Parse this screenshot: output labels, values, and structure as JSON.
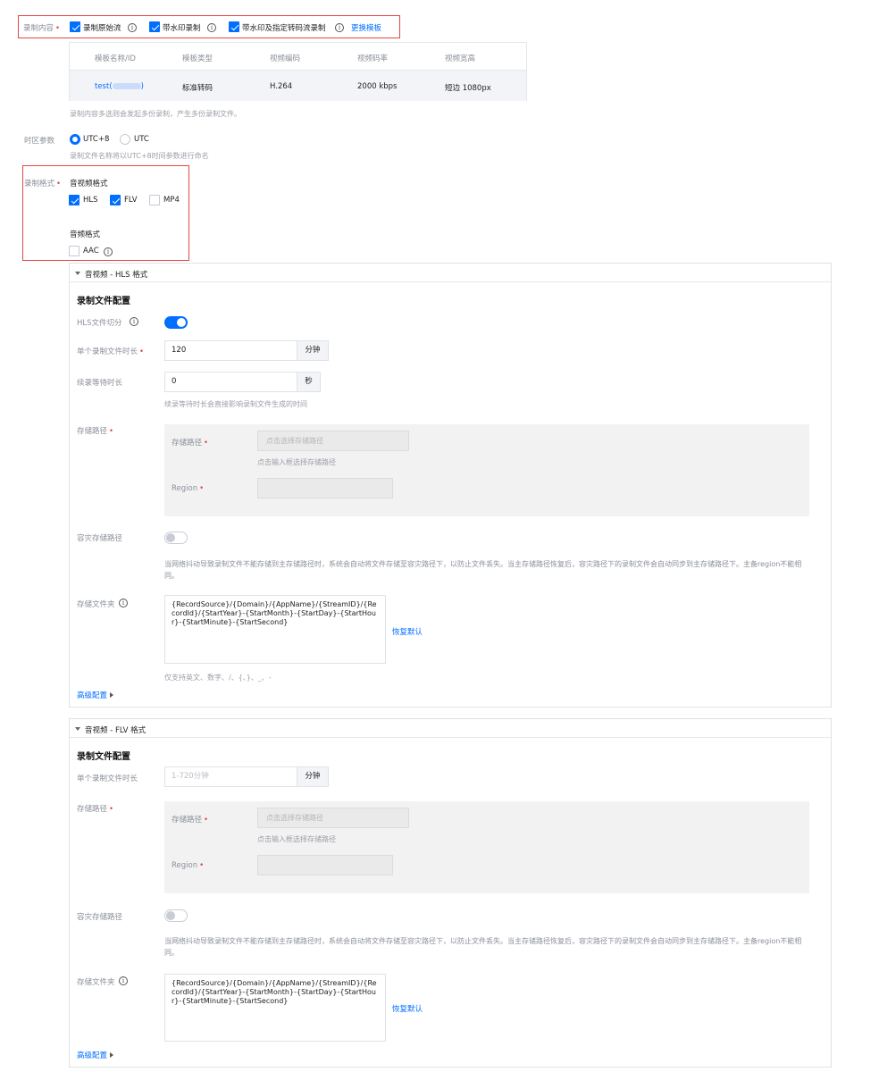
{
  "record_content": {
    "label": "录制内容",
    "options": [
      {
        "label": "录制原始流",
        "checked": true
      },
      {
        "label": "带水印录制",
        "checked": true
      },
      {
        "label": "带水印及指定转码流录制",
        "checked": true
      }
    ],
    "change_template_link": "更换模板",
    "table": {
      "headers": [
        "模板名称/ID",
        "模板类型",
        "视频编码",
        "视频码率",
        "视频宽高"
      ],
      "row": {
        "name_prefix": "test(",
        "name_suffix": ")",
        "type": "标准转码",
        "codec": "H.264",
        "bitrate": "2000 kbps",
        "size": "短边 1080px"
      }
    },
    "hint": "录制内容多选则会发起多份录制，产生多份录制文件。"
  },
  "timezone": {
    "label": "时区参数",
    "options": [
      {
        "label": "UTC+8",
        "selected": true
      },
      {
        "label": "UTC",
        "selected": false
      }
    ],
    "hint": "录制文件名称将以UTC+8时间参数进行命名"
  },
  "record_format": {
    "label": "录制格式",
    "av_title": "音视频格式",
    "av_options": [
      {
        "label": "HLS",
        "checked": true
      },
      {
        "label": "FLV",
        "checked": true
      },
      {
        "label": "MP4",
        "checked": false
      }
    ],
    "audio_title": "音频格式",
    "audio_options": [
      {
        "label": "AAC",
        "checked": false
      }
    ]
  },
  "hls_panel": {
    "header": "音视频 - HLS 格式",
    "section_title": "录制文件配置",
    "split_label": "HLS文件切分",
    "split_on": true,
    "duration_label": "单个录制文件时长",
    "duration_value": "120",
    "duration_unit": "分钟",
    "wait_label": "续录等待时长",
    "wait_value": "0",
    "wait_unit": "秒",
    "wait_hint": "续录等待时长会直接影响录制文件生成的时间",
    "storage_label": "存储路径",
    "storage_path_label": "存储路径",
    "storage_path_placeholder": "点击选择存储路径",
    "storage_path_hint": "点击输入框选择存储路径",
    "region_label": "Region",
    "backup_label": "容灾存储路径",
    "backup_on": false,
    "backup_desc": "当网络抖动导致录制文件不能存储到主存储路径时，系统会自动将文件存储至容灾路径下，以防止文件丢失。当主存储路径恢复后，容灾路径下的录制文件会自动同步到主存储路径下。主备region不能相同。",
    "folder_label": "存储文件夹",
    "folder_value": "{RecordSource}/{Domain}/{AppName}/{StreamID}/{RecordId}/{StartYear}-{StartMonth}-{StartDay}-{StartHour}-{StartMinute}-{StartSecond}",
    "restore_link": "恢复默认",
    "folder_hint": "仅支持英文、数字、/、{、}、_、-",
    "advanced": "高级配置"
  },
  "flv_panel": {
    "header": "音视频 - FLV 格式",
    "section_title": "录制文件配置",
    "duration_label": "单个录制文件时长",
    "duration_placeholder": "1-720分钟",
    "duration_unit": "分钟",
    "storage_label": "存储路径",
    "storage_path_label": "存储路径",
    "storage_path_placeholder": "点击选择存储路径",
    "storage_path_hint": "点击输入框选择存储路径",
    "region_label": "Region",
    "backup_label": "容灾存储路径",
    "backup_on": false,
    "backup_desc": "当网络抖动导致录制文件不能存储到主存储路径时，系统会自动将文件存储至容灾路径下，以防止文件丢失。当主存储路径恢复后，容灾路径下的录制文件会自动同步到主存储路径下。主备region不能相同。",
    "folder_label": "存储文件夹",
    "folder_value": "{RecordSource}/{Domain}/{AppName}/{StreamID}/{RecordId}/{StartYear}-{StartMonth}-{StartDay}-{StartHour}-{StartMinute}-{StartSecond}",
    "restore_link": "恢复默认",
    "advanced": "高级配置"
  },
  "colors": {
    "accent": "#006eff",
    "required": "#e54545",
    "highlight_border": "#e54545"
  }
}
